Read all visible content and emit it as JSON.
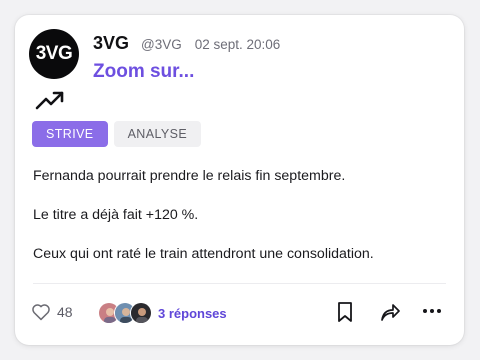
{
  "post": {
    "avatar_text": "3VG",
    "author_name": "3VG",
    "author_handle": "@3VG",
    "timestamp": "02 sept. 20:06",
    "title": "Zoom sur...",
    "title_color": "#6d4fe0",
    "trend_icon": "trending-up-icon",
    "tags": [
      {
        "label": "STRIVE",
        "style": "primary"
      },
      {
        "label": "ANALYSE",
        "style": "secondary"
      }
    ],
    "body": [
      "Fernanda pourrait prendre le relais fin septembre.",
      "Le titre a déjà fait +120 %.",
      "Ceux qui ont raté le train attendront une consolidation."
    ]
  },
  "footer": {
    "like_icon": "heart-icon",
    "like_count": "48",
    "replies_label": "3 réponses",
    "actions": [
      "bookmark-icon",
      "share-icon",
      "more-icon"
    ]
  }
}
